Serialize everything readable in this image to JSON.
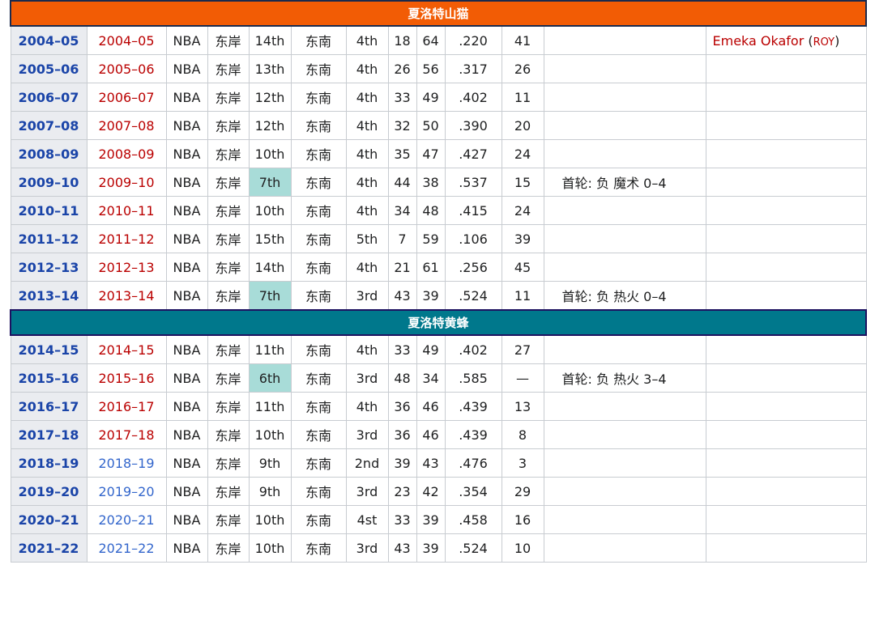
{
  "sections": [
    {
      "team": "夏洛特山猫",
      "color": "#f25c05",
      "rows": [
        {
          "season": "2004–05",
          "link": "2004–05",
          "link_style": "red",
          "league": "NBA",
          "conf": "东岸",
          "conf_rank": "14th",
          "div": "东南",
          "div_rank": "4th",
          "w": "18",
          "l": "64",
          "pct": ".220",
          "gb": "41",
          "playoffs": "",
          "award_name": "Emeka Okafor",
          "award_code": "ROY"
        },
        {
          "season": "2005–06",
          "link": "2005–06",
          "link_style": "red",
          "league": "NBA",
          "conf": "东岸",
          "conf_rank": "13th",
          "div": "东南",
          "div_rank": "4th",
          "w": "26",
          "l": "56",
          "pct": ".317",
          "gb": "26",
          "playoffs": ""
        },
        {
          "season": "2006–07",
          "link": "2006–07",
          "link_style": "red",
          "league": "NBA",
          "conf": "东岸",
          "conf_rank": "12th",
          "div": "东南",
          "div_rank": "4th",
          "w": "33",
          "l": "49",
          "pct": ".402",
          "gb": "11",
          "playoffs": ""
        },
        {
          "season": "2007–08",
          "link": "2007–08",
          "link_style": "red",
          "league": "NBA",
          "conf": "东岸",
          "conf_rank": "12th",
          "div": "东南",
          "div_rank": "4th",
          "w": "32",
          "l": "50",
          "pct": ".390",
          "gb": "20",
          "playoffs": ""
        },
        {
          "season": "2008–09",
          "link": "2008–09",
          "link_style": "red",
          "league": "NBA",
          "conf": "东岸",
          "conf_rank": "10th",
          "div": "东南",
          "div_rank": "4th",
          "w": "35",
          "l": "47",
          "pct": ".427",
          "gb": "24",
          "playoffs": ""
        },
        {
          "season": "2009–10",
          "link": "2009–10",
          "link_style": "red",
          "league": "NBA",
          "conf": "东岸",
          "conf_rank": "7th",
          "hl": true,
          "div": "东南",
          "div_rank": "4th",
          "w": "44",
          "l": "38",
          "pct": ".537",
          "gb": "15",
          "playoffs": "首轮: 负 魔术 0–4"
        },
        {
          "season": "2010–11",
          "link": "2010–11",
          "link_style": "red",
          "league": "NBA",
          "conf": "东岸",
          "conf_rank": "10th",
          "div": "东南",
          "div_rank": "4th",
          "w": "34",
          "l": "48",
          "pct": ".415",
          "gb": "24",
          "playoffs": ""
        },
        {
          "season": "2011–12",
          "link": "2011–12",
          "link_style": "red",
          "league": "NBA",
          "conf": "东岸",
          "conf_rank": "15th",
          "div": "东南",
          "div_rank": "5th",
          "w": "7",
          "l": "59",
          "pct": ".106",
          "gb": "39",
          "playoffs": ""
        },
        {
          "season": "2012–13",
          "link": "2012–13",
          "link_style": "red",
          "league": "NBA",
          "conf": "东岸",
          "conf_rank": "14th",
          "div": "东南",
          "div_rank": "4th",
          "w": "21",
          "l": "61",
          "pct": ".256",
          "gb": "45",
          "playoffs": ""
        },
        {
          "season": "2013–14",
          "link": "2013–14",
          "link_style": "red",
          "league": "NBA",
          "conf": "东岸",
          "conf_rank": "7th",
          "hl": true,
          "div": "东南",
          "div_rank": "3rd",
          "w": "43",
          "l": "39",
          "pct": ".524",
          "gb": "11",
          "playoffs": "首轮: 负 热火 0–4"
        }
      ]
    },
    {
      "team": "夏洛特黄蜂",
      "color": "#00788c",
      "rows": [
        {
          "season": "2014–15",
          "link": "2014–15",
          "link_style": "red",
          "league": "NBA",
          "conf": "东岸",
          "conf_rank": "11th",
          "div": "东南",
          "div_rank": "4th",
          "w": "33",
          "l": "49",
          "pct": ".402",
          "gb": "27",
          "playoffs": ""
        },
        {
          "season": "2015–16",
          "link": "2015–16",
          "link_style": "red",
          "league": "NBA",
          "conf": "东岸",
          "conf_rank": "6th",
          "hl": true,
          "div": "东南",
          "div_rank": "3rd",
          "w": "48",
          "l": "34",
          "pct": ".585",
          "gb": "—",
          "playoffs": "首轮: 负 热火 3–4"
        },
        {
          "season": "2016–17",
          "link": "2016–17",
          "link_style": "red",
          "league": "NBA",
          "conf": "东岸",
          "conf_rank": "11th",
          "div": "东南",
          "div_rank": "4th",
          "w": "36",
          "l": "46",
          "pct": ".439",
          "gb": "13",
          "playoffs": ""
        },
        {
          "season": "2017–18",
          "link": "2017–18",
          "link_style": "red",
          "league": "NBA",
          "conf": "东岸",
          "conf_rank": "10th",
          "div": "东南",
          "div_rank": "3rd",
          "w": "36",
          "l": "46",
          "pct": ".439",
          "gb": "8",
          "playoffs": ""
        },
        {
          "season": "2018–19",
          "link": "2018–19",
          "link_style": "blue",
          "league": "NBA",
          "conf": "东岸",
          "conf_rank": "9th",
          "div": "东南",
          "div_rank": "2nd",
          "w": "39",
          "l": "43",
          "pct": ".476",
          "gb": "3",
          "playoffs": ""
        },
        {
          "season": "2019–20",
          "link": "2019–20",
          "link_style": "blue",
          "league": "NBA",
          "conf": "东岸",
          "conf_rank": "9th",
          "div": "东南",
          "div_rank": "3rd",
          "w": "23",
          "l": "42",
          "pct": ".354",
          "gb": "29",
          "playoffs": ""
        },
        {
          "season": "2020–21",
          "link": "2020–21",
          "link_style": "blue",
          "league": "NBA",
          "conf": "东岸",
          "conf_rank": "10th",
          "div": "东南",
          "div_rank": "4st",
          "w": "33",
          "l": "39",
          "pct": ".458",
          "gb": "16",
          "playoffs": ""
        },
        {
          "season": "2021–22",
          "link": "2021–22",
          "link_style": "blue",
          "league": "NBA",
          "conf": "东岸",
          "conf_rank": "10th",
          "div": "东南",
          "div_rank": "3rd",
          "w": "43",
          "l": "39",
          "pct": ".524",
          "gb": "10",
          "playoffs": ""
        }
      ]
    }
  ]
}
